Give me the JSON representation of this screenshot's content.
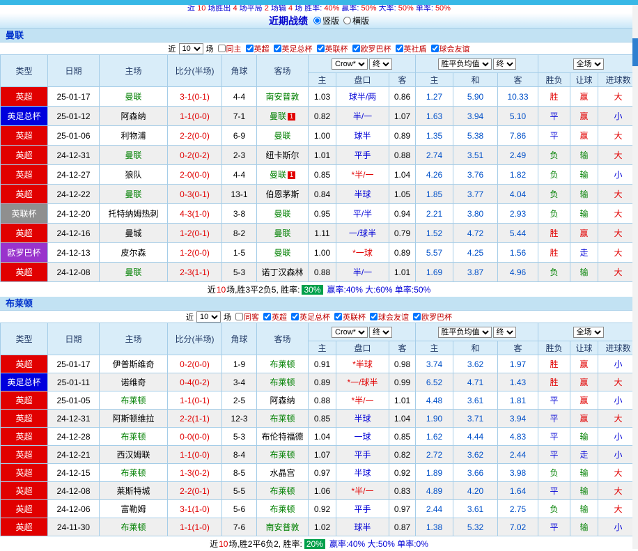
{
  "palette": {
    "red": "#e10000",
    "blue": "#0000d6",
    "green": "#008000",
    "black": "#000000",
    "avg": "#0050c8",
    "league": {
      "英超": "#e10000",
      "英足总杯": "#0000dd",
      "英联杯": "#8f8f8f",
      "欧罗巴杯": "#9933cc"
    },
    "result": {
      "胜": "#e10000",
      "平": "#0000d6",
      "负": "#008000",
      "赢": "#e10000",
      "输": "#008000",
      "走": "#0000d6",
      "大": "#e10000",
      "小": "#0000d6"
    }
  },
  "top_bar": {
    "segments": [
      {
        "text": "近 ",
        "color": "blue"
      },
      {
        "text": "10",
        "color": "red"
      },
      {
        "text": " 场胜出 ",
        "color": "blue"
      },
      {
        "text": "4",
        "color": "red"
      },
      {
        "text": " 场平局 ",
        "color": "blue"
      },
      {
        "text": "2",
        "color": "red"
      },
      {
        "text": " 场输 ",
        "color": "blue"
      },
      {
        "text": "4",
        "color": "red"
      },
      {
        "text": " 场 胜率: ",
        "color": "blue"
      },
      {
        "text": "40%",
        "color": "red"
      },
      {
        "text": " 赢率: ",
        "color": "blue"
      },
      {
        "text": "50%",
        "color": "red"
      },
      {
        "text": " 大率: ",
        "color": "blue"
      },
      {
        "text": "50%",
        "color": "red"
      },
      {
        "text": " 单率: ",
        "color": "blue"
      },
      {
        "text": "50%",
        "color": "red"
      }
    ]
  },
  "header": {
    "title": "近期战绩",
    "radios": [
      {
        "label": "竖版",
        "checked": true
      },
      {
        "label": "横版",
        "checked": false
      }
    ]
  },
  "table_header": {
    "type": "类型",
    "date": "日期",
    "home": "主场",
    "score": "比分(半场)",
    "corner": "角球",
    "away": "客场",
    "odds_company": "Crow*",
    "final1": "终",
    "avg_label": "胜平负均值",
    "final2": "终",
    "scope": "全场",
    "sub_home": "主",
    "sub_handicap": "盘口",
    "sub_away": "客",
    "sub_win": "主",
    "sub_draw": "和",
    "sub_lose": "客",
    "sub_wdl": "胜负",
    "sub_let": "让球",
    "sub_goals": "进球数"
  },
  "sections": [
    {
      "team": "曼联",
      "filter": {
        "pre": "近",
        "count": "10",
        "post": "场",
        "checkboxes": [
          {
            "label": "同主",
            "checked": false
          },
          {
            "label": "英超",
            "checked": true
          },
          {
            "label": "英足总杯",
            "checked": true
          },
          {
            "label": "英联杯",
            "checked": true
          },
          {
            "label": "欧罗巴杯",
            "checked": true
          },
          {
            "label": "英社盾",
            "checked": true
          },
          {
            "label": "球会友谊",
            "checked": true
          }
        ]
      },
      "rows": [
        {
          "type": "英超",
          "date": "25-01-17",
          "home": "曼联",
          "hg": true,
          "score": "3-1(0-1)",
          "corner": "4-4",
          "away": "南安普敦",
          "ag": true,
          "abadge": "",
          "o1": "1.03",
          "hc": "球半/两",
          "o2": "0.86",
          "a1": "1.27",
          "a2": "5.90",
          "a3": "10.33",
          "r1": "胜",
          "r2": "赢",
          "r3": "大"
        },
        {
          "type": "英足总杯",
          "date": "25-01-12",
          "home": "阿森纳",
          "hg": false,
          "score": "1-1(0-0)",
          "corner": "7-1",
          "away": "曼联",
          "ag": true,
          "abadge": "1",
          "o1": "0.82",
          "hc": "半/一",
          "o2": "1.07",
          "a1": "1.63",
          "a2": "3.94",
          "a3": "5.10",
          "r1": "平",
          "r2": "赢",
          "r3": "小"
        },
        {
          "type": "英超",
          "date": "25-01-06",
          "home": "利物浦",
          "hg": false,
          "score": "2-2(0-0)",
          "corner": "6-9",
          "away": "曼联",
          "ag": true,
          "abadge": "",
          "o1": "1.00",
          "hc": "球半",
          "o2": "0.89",
          "a1": "1.35",
          "a2": "5.38",
          "a3": "7.86",
          "r1": "平",
          "r2": "赢",
          "r3": "大"
        },
        {
          "type": "英超",
          "date": "24-12-31",
          "home": "曼联",
          "hg": true,
          "score": "0-2(0-2)",
          "corner": "2-3",
          "away": "纽卡斯尔",
          "ag": false,
          "abadge": "",
          "o1": "1.01",
          "hc": "平手",
          "o2": "0.88",
          "a1": "2.74",
          "a2": "3.51",
          "a3": "2.49",
          "r1": "负",
          "r2": "输",
          "r3": "大"
        },
        {
          "type": "英超",
          "date": "24-12-27",
          "home": "狼队",
          "hg": false,
          "score": "2-0(0-0)",
          "corner": "4-4",
          "away": "曼联",
          "ag": true,
          "abadge": "1",
          "o1": "0.85",
          "hc": "*半/一",
          "o2": "1.04",
          "a1": "4.26",
          "a2": "3.76",
          "a3": "1.82",
          "r1": "负",
          "r2": "输",
          "r3": "小"
        },
        {
          "type": "英超",
          "date": "24-12-22",
          "home": "曼联",
          "hg": true,
          "score": "0-3(0-1)",
          "corner": "13-1",
          "away": "伯恩茅斯",
          "ag": false,
          "abadge": "",
          "o1": "0.84",
          "hc": "半球",
          "o2": "1.05",
          "a1": "1.85",
          "a2": "3.77",
          "a3": "4.04",
          "r1": "负",
          "r2": "输",
          "r3": "大"
        },
        {
          "type": "英联杯",
          "date": "24-12-20",
          "home": "托特纳姆热刺",
          "hg": false,
          "score": "4-3(1-0)",
          "corner": "3-8",
          "away": "曼联",
          "ag": true,
          "abadge": "",
          "o1": "0.95",
          "hc": "平/半",
          "o2": "0.94",
          "a1": "2.21",
          "a2": "3.80",
          "a3": "2.93",
          "r1": "负",
          "r2": "输",
          "r3": "大"
        },
        {
          "type": "英超",
          "date": "24-12-16",
          "home": "曼城",
          "hg": false,
          "score": "1-2(0-1)",
          "corner": "8-2",
          "away": "曼联",
          "ag": true,
          "abadge": "",
          "o1": "1.11",
          "hc": "一/球半",
          "o2": "0.79",
          "a1": "1.52",
          "a2": "4.72",
          "a3": "5.44",
          "r1": "胜",
          "r2": "赢",
          "r3": "大"
        },
        {
          "type": "欧罗巴杯",
          "date": "24-12-13",
          "home": "皮尔森",
          "hg": false,
          "score": "1-2(0-0)",
          "corner": "1-5",
          "away": "曼联",
          "ag": true,
          "abadge": "",
          "o1": "1.00",
          "hc": "*一球",
          "o2": "0.89",
          "a1": "5.57",
          "a2": "4.25",
          "a3": "1.56",
          "r1": "胜",
          "r2": "走",
          "r3": "大"
        },
        {
          "type": "英超",
          "date": "24-12-08",
          "home": "曼联",
          "hg": true,
          "score": "2-3(1-1)",
          "corner": "5-3",
          "away": "诺丁汉森林",
          "ag": false,
          "abadge": "",
          "o1": "0.88",
          "hc": "半/一",
          "o2": "1.01",
          "a1": "1.69",
          "a2": "3.87",
          "a3": "4.96",
          "r1": "负",
          "r2": "输",
          "r3": "大"
        }
      ],
      "summary": {
        "pre": "近",
        "count": "10",
        "mid": "场,胜3平2负5, 胜率: ",
        "rate": "30%",
        "tail": "赢率:40% 大:60% 单率:50%"
      }
    },
    {
      "team": "布莱顿",
      "filter": {
        "pre": "近",
        "count": "10",
        "post": "场",
        "checkboxes": [
          {
            "label": "同客",
            "checked": false
          },
          {
            "label": "英超",
            "checked": true
          },
          {
            "label": "英足总杯",
            "checked": true
          },
          {
            "label": "英联杯",
            "checked": true
          },
          {
            "label": "球会友谊",
            "checked": true
          },
          {
            "label": "欧罗巴杯",
            "checked": true
          }
        ]
      },
      "rows": [
        {
          "type": "英超",
          "date": "25-01-17",
          "home": "伊普斯维奇",
          "hg": false,
          "score": "0-2(0-0)",
          "corner": "1-9",
          "away": "布莱顿",
          "ag": true,
          "abadge": "",
          "o1": "0.91",
          "hc": "*半球",
          "o2": "0.98",
          "a1": "3.74",
          "a2": "3.62",
          "a3": "1.97",
          "r1": "胜",
          "r2": "赢",
          "r3": "小"
        },
        {
          "type": "英足总杯",
          "date": "25-01-11",
          "home": "诺维奇",
          "hg": false,
          "score": "0-4(0-2)",
          "corner": "3-4",
          "away": "布莱顿",
          "ag": true,
          "abadge": "",
          "o1": "0.89",
          "hc": "*一/球半",
          "o2": "0.99",
          "a1": "6.52",
          "a2": "4.71",
          "a3": "1.43",
          "r1": "胜",
          "r2": "赢",
          "r3": "大"
        },
        {
          "type": "英超",
          "date": "25-01-05",
          "home": "布莱顿",
          "hg": true,
          "score": "1-1(0-1)",
          "corner": "2-5",
          "away": "阿森纳",
          "ag": false,
          "abadge": "",
          "o1": "0.88",
          "hc": "*半/一",
          "o2": "1.01",
          "a1": "4.48",
          "a2": "3.61",
          "a3": "1.81",
          "r1": "平",
          "r2": "赢",
          "r3": "小"
        },
        {
          "type": "英超",
          "date": "24-12-31",
          "home": "阿斯顿维拉",
          "hg": false,
          "score": "2-2(1-1)",
          "corner": "12-3",
          "away": "布莱顿",
          "ag": true,
          "abadge": "",
          "o1": "0.85",
          "hc": "半球",
          "o2": "1.04",
          "a1": "1.90",
          "a2": "3.71",
          "a3": "3.94",
          "r1": "平",
          "r2": "赢",
          "r3": "大"
        },
        {
          "type": "英超",
          "date": "24-12-28",
          "home": "布莱顿",
          "hg": true,
          "score": "0-0(0-0)",
          "corner": "5-3",
          "away": "布伦特福德",
          "ag": false,
          "abadge": "",
          "o1": "1.04",
          "hc": "一球",
          "o2": "0.85",
          "a1": "1.62",
          "a2": "4.44",
          "a3": "4.83",
          "r1": "平",
          "r2": "输",
          "r3": "小"
        },
        {
          "type": "英超",
          "date": "24-12-21",
          "home": "西汉姆联",
          "hg": false,
          "score": "1-1(0-0)",
          "corner": "8-4",
          "away": "布莱顿",
          "ag": true,
          "abadge": "",
          "o1": "1.07",
          "hc": "平手",
          "o2": "0.82",
          "a1": "2.72",
          "a2": "3.62",
          "a3": "2.44",
          "r1": "平",
          "r2": "走",
          "r3": "小"
        },
        {
          "type": "英超",
          "date": "24-12-15",
          "home": "布莱顿",
          "hg": true,
          "score": "1-3(0-2)",
          "corner": "8-5",
          "away": "水晶宫",
          "ag": false,
          "abadge": "",
          "o1": "0.97",
          "hc": "半球",
          "o2": "0.92",
          "a1": "1.89",
          "a2": "3.66",
          "a3": "3.98",
          "r1": "负",
          "r2": "输",
          "r3": "大"
        },
        {
          "type": "英超",
          "date": "24-12-08",
          "home": "莱斯特城",
          "hg": false,
          "score": "2-2(0-1)",
          "corner": "5-5",
          "away": "布莱顿",
          "ag": true,
          "abadge": "",
          "o1": "1.06",
          "hc": "*半/一",
          "o2": "0.83",
          "a1": "4.89",
          "a2": "4.20",
          "a3": "1.64",
          "r1": "平",
          "r2": "输",
          "r3": "大"
        },
        {
          "type": "英超",
          "date": "24-12-06",
          "home": "富勒姆",
          "hg": false,
          "score": "3-1(1-0)",
          "corner": "5-6",
          "away": "布莱顿",
          "ag": true,
          "abadge": "",
          "o1": "0.92",
          "hc": "平手",
          "o2": "0.97",
          "a1": "2.44",
          "a2": "3.61",
          "a3": "2.75",
          "r1": "负",
          "r2": "输",
          "r3": "大"
        },
        {
          "type": "英超",
          "date": "24-11-30",
          "home": "布莱顿",
          "hg": true,
          "score": "1-1(1-0)",
          "corner": "7-6",
          "away": "南安普敦",
          "ag": true,
          "abadge": "",
          "o1": "1.02",
          "hc": "球半",
          "o2": "0.87",
          "a1": "1.38",
          "a2": "5.32",
          "a3": "7.02",
          "r1": "平",
          "r2": "输",
          "r3": "小"
        }
      ],
      "summary": {
        "pre": "近",
        "count": "10",
        "mid": "场,胜2平6负2, 胜率: ",
        "rate": "20%",
        "tail": "赢率:40% 大:50% 单率:0%"
      }
    }
  ]
}
